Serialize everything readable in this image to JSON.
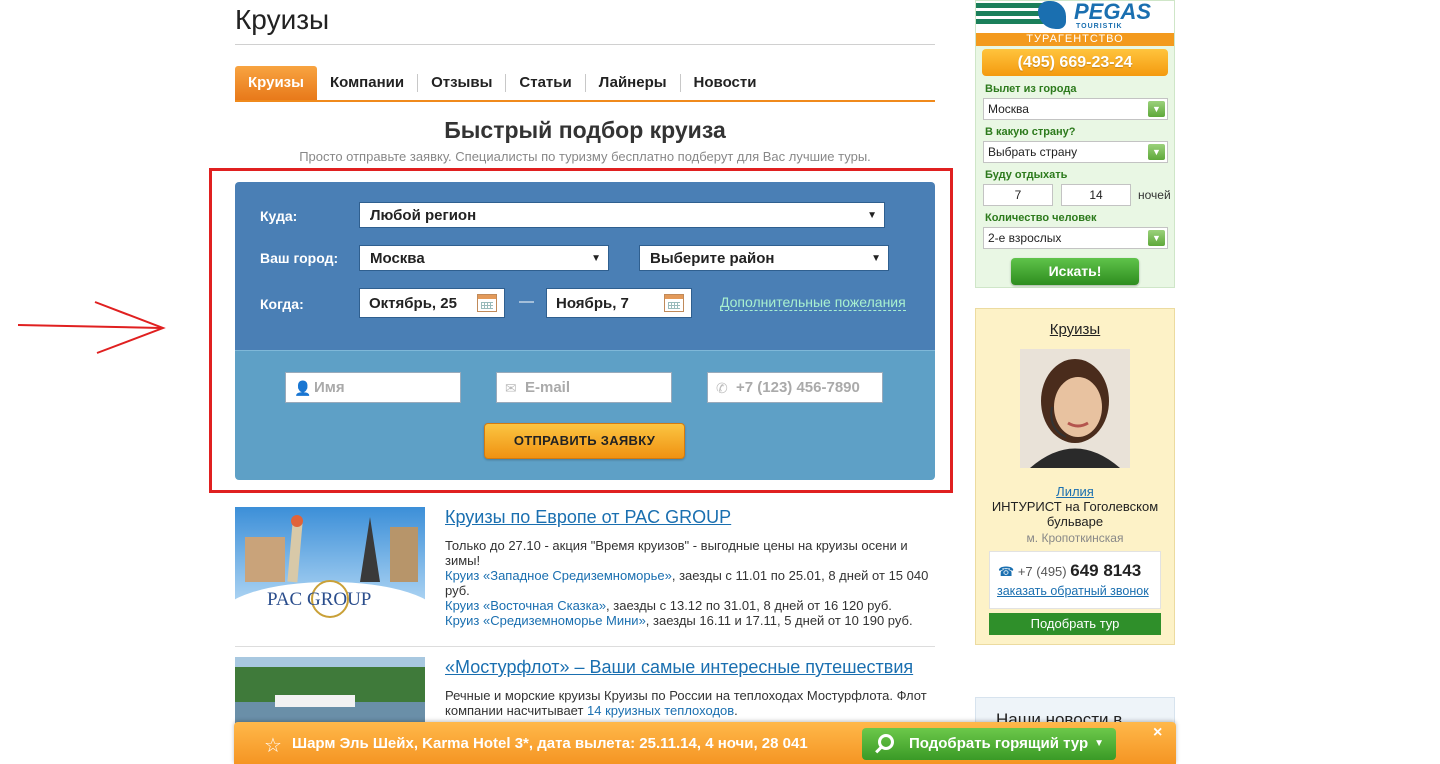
{
  "header": {
    "title": "Круизы"
  },
  "tabs": [
    {
      "label": "Круизы",
      "active": true
    },
    {
      "label": "Компании"
    },
    {
      "label": "Отзывы"
    },
    {
      "label": "Статьи"
    },
    {
      "label": "Лайнеры"
    },
    {
      "label": "Новости"
    }
  ],
  "quick": {
    "title": "Быстрый подбор круиза",
    "subtitle": "Просто отправьте заявку. Специалисты по туризму бесплатно подберут для Вас лучшие туры."
  },
  "form": {
    "where_label": "Куда:",
    "where_value": "Любой регион",
    "city_label": "Ваш город:",
    "city_value": "Москва",
    "district_value": "Выберите район",
    "when_label": "Когда:",
    "date_from": "Октябрь, 25",
    "date_to": "Ноябрь, 7",
    "date_sep": "—",
    "extra_link": "Дополнительные пожелания",
    "name_placeholder": "Имя",
    "email_placeholder": "E-mail",
    "phone_placeholder": "+7 (123) 456-7890",
    "submit_label": "ОТПРАВИТЬ ЗАЯВКУ"
  },
  "articles": [
    {
      "title": "Круизы по Европе от PAC GROUP",
      "text1": "Только до 27.10 - акция \"Время круизов\" - выгодные цены на круизы осени и зимы!",
      "link1": "Круиз «Западное Средиземноморье»",
      "text2": ", заезды с 11.01 по 25.01, 8 дней от 15 040 руб.",
      "link2": "Круиз «Восточная Сказка»",
      "text3": ", заезды с 13.12 по 31.01, 8 дней от 16 120 руб.",
      "link3": "Круиз «Средиземноморье Мини»",
      "text4": ", заезды 16.11 и 17.11, 5 дней от 10 190 руб.",
      "image_logo": "PAC GROUP"
    },
    {
      "title": "«Мостурфлот» – Ваши самые интересные путешествия",
      "text1": "Речные и морские круизы Круизы по России на теплоходах Мостурфлота. Флот компании насчитывает ",
      "link1": "14 круизных теплоходов",
      "text2": "."
    }
  ],
  "right_widget": {
    "logo": "PEGAS",
    "logo_sub": "TOURISTIK",
    "agency": "ТУРАГЕНТСТВО",
    "phone": "(495) 669-23-24",
    "from_label": "Вылет из города",
    "from_value": "Москва",
    "country_label": "В какую страну?",
    "country_value": "Выбрать страну",
    "rest_label": "Буду отдыхать",
    "nights_from": "7",
    "nights_to": "14",
    "nights_label": "ночей",
    "people_label": "Количество человек",
    "people_value": "2-е взрослых",
    "search_label": "Искать!"
  },
  "agent": {
    "title": "Круизы",
    "name": "Лилия",
    "office": "ИНТУРИСТ на Гоголевском бульваре",
    "metro": "м. Кропоткинская",
    "phone_prefix": "+7 (495)",
    "phone_number": "649 8143",
    "callback": "заказать обратный звонок",
    "tour_button": "Подобрать тур"
  },
  "news": {
    "title": "Наши новости в"
  },
  "hot_bar": {
    "text": "Шарм Эль Шейх, Karma Hotel 3*, дата вылета: 25.11.14, 4 ночи, 28 041 р",
    "button": "Подобрать горящий тур",
    "close": "×"
  },
  "colors": {
    "accent_orange": "#f08a1c",
    "form_blue": "#4a7fb5",
    "form_light_blue": "#5ea0c6",
    "highlight_red": "#e02020",
    "link_blue": "#1a6fb0",
    "green": "#2f8f2a"
  }
}
